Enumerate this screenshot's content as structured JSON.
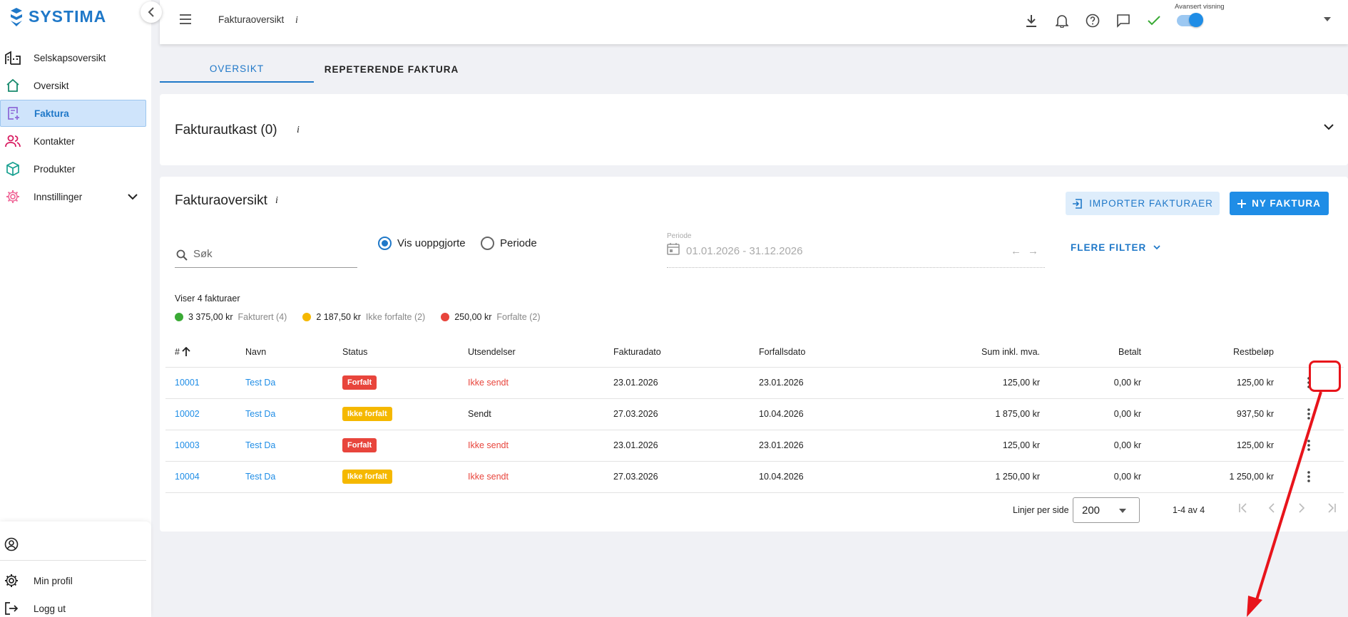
{
  "app": {
    "logo_text": "SYSTIMA"
  },
  "sidebar": {
    "items": [
      {
        "label": "Selskapsoversikt",
        "icon": "buildings-icon"
      },
      {
        "label": "Oversikt",
        "icon": "home-icon"
      },
      {
        "label": "Faktura",
        "icon": "invoice-icon"
      },
      {
        "label": "Kontakter",
        "icon": "contacts-icon"
      },
      {
        "label": "Produkter",
        "icon": "box-icon"
      },
      {
        "label": "Innstillinger",
        "icon": "gear-icon"
      }
    ],
    "bottom": {
      "profile_label": "Min profil",
      "logout_label": "Logg ut"
    }
  },
  "topbar": {
    "title": "Fakturaoversikt",
    "info": "i",
    "toggle_label": "Avansert visning",
    "toggle_on": true
  },
  "tabs": [
    "OVERSIKT",
    "REPETERENDE FAKTURA"
  ],
  "drafts": {
    "title": "Fakturautkast (0)",
    "info": "i"
  },
  "overview": {
    "title": "Fakturaoversikt",
    "info": "i",
    "import_label": "IMPORTER FAKTURAER",
    "new_label": "NY FAKTURA",
    "search_placeholder": "Søk",
    "radio_unsettled": "Vis uoppgjorte",
    "radio_period": "Periode",
    "period_label": "Periode",
    "period_value": "01.01.2026 - 31.12.2026",
    "period_prev": "←",
    "period_next": "→",
    "more_filters": "FLERE FILTER",
    "showing": "Viser 4 fakturaer",
    "summary": [
      {
        "amount": "3 375,00 kr",
        "label": "Fakturert (4)",
        "color": "#3aaa35"
      },
      {
        "amount": "2 187,50 kr",
        "label": "Ikke forfalte (2)",
        "color": "#f5b800"
      },
      {
        "amount": "250,00 kr",
        "label": "Forfalte (2)",
        "color": "#e8453c"
      }
    ],
    "columns": [
      "#",
      "Navn",
      "Status",
      "Utsendelser",
      "Fakturadato",
      "Forfallsdato",
      "Sum inkl. mva.",
      "Betalt",
      "Restbeløp"
    ],
    "rows": [
      {
        "no": "10001",
        "name": "Test Da",
        "status": "Forfalt",
        "status_color": "#e8453c",
        "sent": "Ikke sendt",
        "sent_red": true,
        "inv_date": "23.01.2026",
        "due_date": "23.01.2026",
        "sum": "125,00 kr",
        "paid": "0,00 kr",
        "rest": "125,00 kr"
      },
      {
        "no": "10002",
        "name": "Test Da",
        "status": "Ikke forfalt",
        "status_color": "#f5b800",
        "sent": "Sendt",
        "sent_red": false,
        "inv_date": "27.03.2026",
        "due_date": "10.04.2026",
        "sum": "1 875,00 kr",
        "paid": "0,00 kr",
        "rest": "937,50 kr"
      },
      {
        "no": "10003",
        "name": "Test Da",
        "status": "Forfalt",
        "status_color": "#e8453c",
        "sent": "Ikke sendt",
        "sent_red": true,
        "inv_date": "23.01.2026",
        "due_date": "23.01.2026",
        "sum": "125,00 kr",
        "paid": "0,00 kr",
        "rest": "125,00 kr"
      },
      {
        "no": "10004",
        "name": "Test Da",
        "status": "Ikke forfalt",
        "status_color": "#f5b800",
        "sent": "Ikke sendt",
        "sent_red": true,
        "inv_date": "27.03.2026",
        "due_date": "10.04.2026",
        "sum": "1 250,00 kr",
        "paid": "0,00 kr",
        "rest": "1 250,00 kr"
      }
    ],
    "pager": {
      "rows_per_page_label": "Linjer per side",
      "rows_per_page": "200",
      "range": "1-4 av 4"
    }
  },
  "colors": {
    "accent": "#1f8de6",
    "annotation": "#e8141b"
  }
}
